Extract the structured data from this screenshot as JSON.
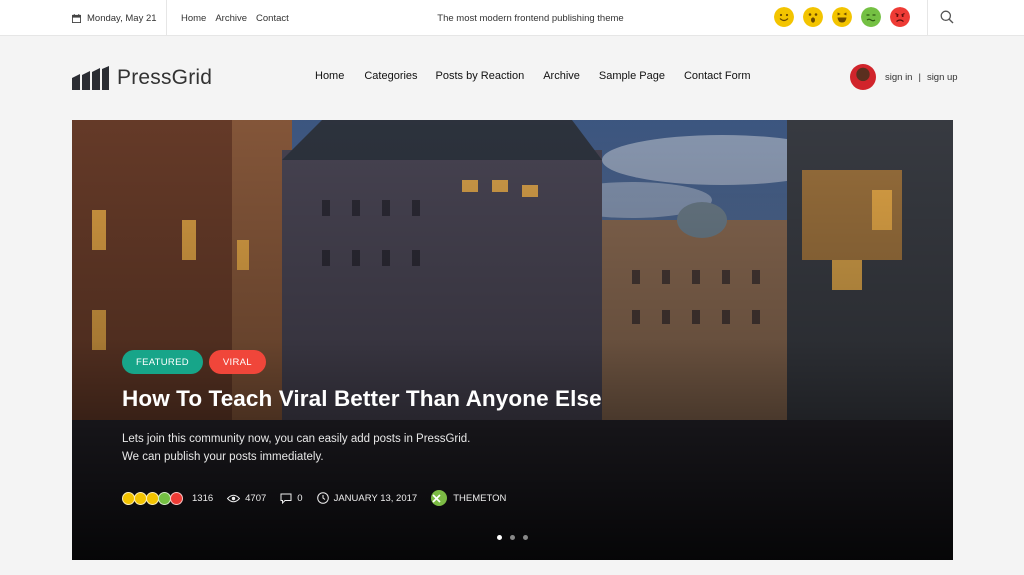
{
  "topbar": {
    "date": "Monday, May 21",
    "links": [
      "Home",
      "Archive",
      "Contact"
    ],
    "tagline": "The most modern frontend publishing theme",
    "reactions": [
      {
        "name": "smile",
        "color": "#f3c400"
      },
      {
        "name": "wow",
        "color": "#f3c400"
      },
      {
        "name": "laugh",
        "color": "#f3c400"
      },
      {
        "name": "sick",
        "color": "#74c043"
      },
      {
        "name": "angry",
        "color": "#ee3b35"
      }
    ]
  },
  "header": {
    "logo_text": "PressGrid",
    "nav": [
      "Home",
      "Categories",
      "Posts by Reaction",
      "Archive",
      "Sample Page",
      "Contact Form"
    ],
    "sign_in": "sign in",
    "sign_divider": "|",
    "sign_up": "sign up"
  },
  "hero": {
    "badges": [
      {
        "label": "FEATURED",
        "color": "#17a589"
      },
      {
        "label": "VIRAL",
        "color": "#f0463a"
      }
    ],
    "title": "How To Teach Viral Better Than Anyone Else",
    "excerpt_line1": "Lets join this community now, you can easily add posts in PressGrid.",
    "excerpt_line2": "We can publish your posts immediately.",
    "reaction_count": "1316",
    "views": "4707",
    "comments": "0",
    "date": "JANUARY 13, 2017",
    "author": "THEMETON",
    "slides": 3,
    "active_slide": 1
  },
  "colors": {
    "accent_green": "#17a589",
    "accent_red": "#f0463a"
  }
}
